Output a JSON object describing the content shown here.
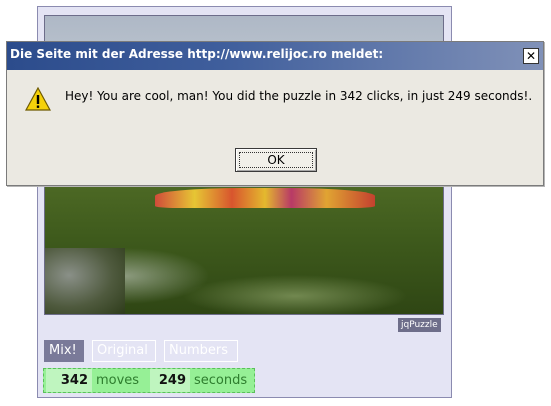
{
  "puzzle": {
    "brand_tag": "jqPuzzle",
    "buttons": {
      "mix": "Mix!",
      "original": "Original",
      "numbers": "Numbers"
    },
    "stats": {
      "moves_value": "342",
      "moves_label": "moves",
      "seconds_value": "249",
      "seconds_label": "seconds"
    }
  },
  "dialog": {
    "title": "Die Seite mit der Adresse http://www.relijoc.ro meldet:",
    "close_glyph": "✕",
    "message": "Hey! You are cool, man! You did the puzzle in  342  clicks, in just  249  seconds!.",
    "ok_label": "OK"
  },
  "colors": {
    "titlebar": "#2c4c8c",
    "stats_bg": "#96f096",
    "stats_text": "#2e7d2e",
    "panel_bg": "#e4e4f4",
    "mix_button": "#7a7a99"
  }
}
